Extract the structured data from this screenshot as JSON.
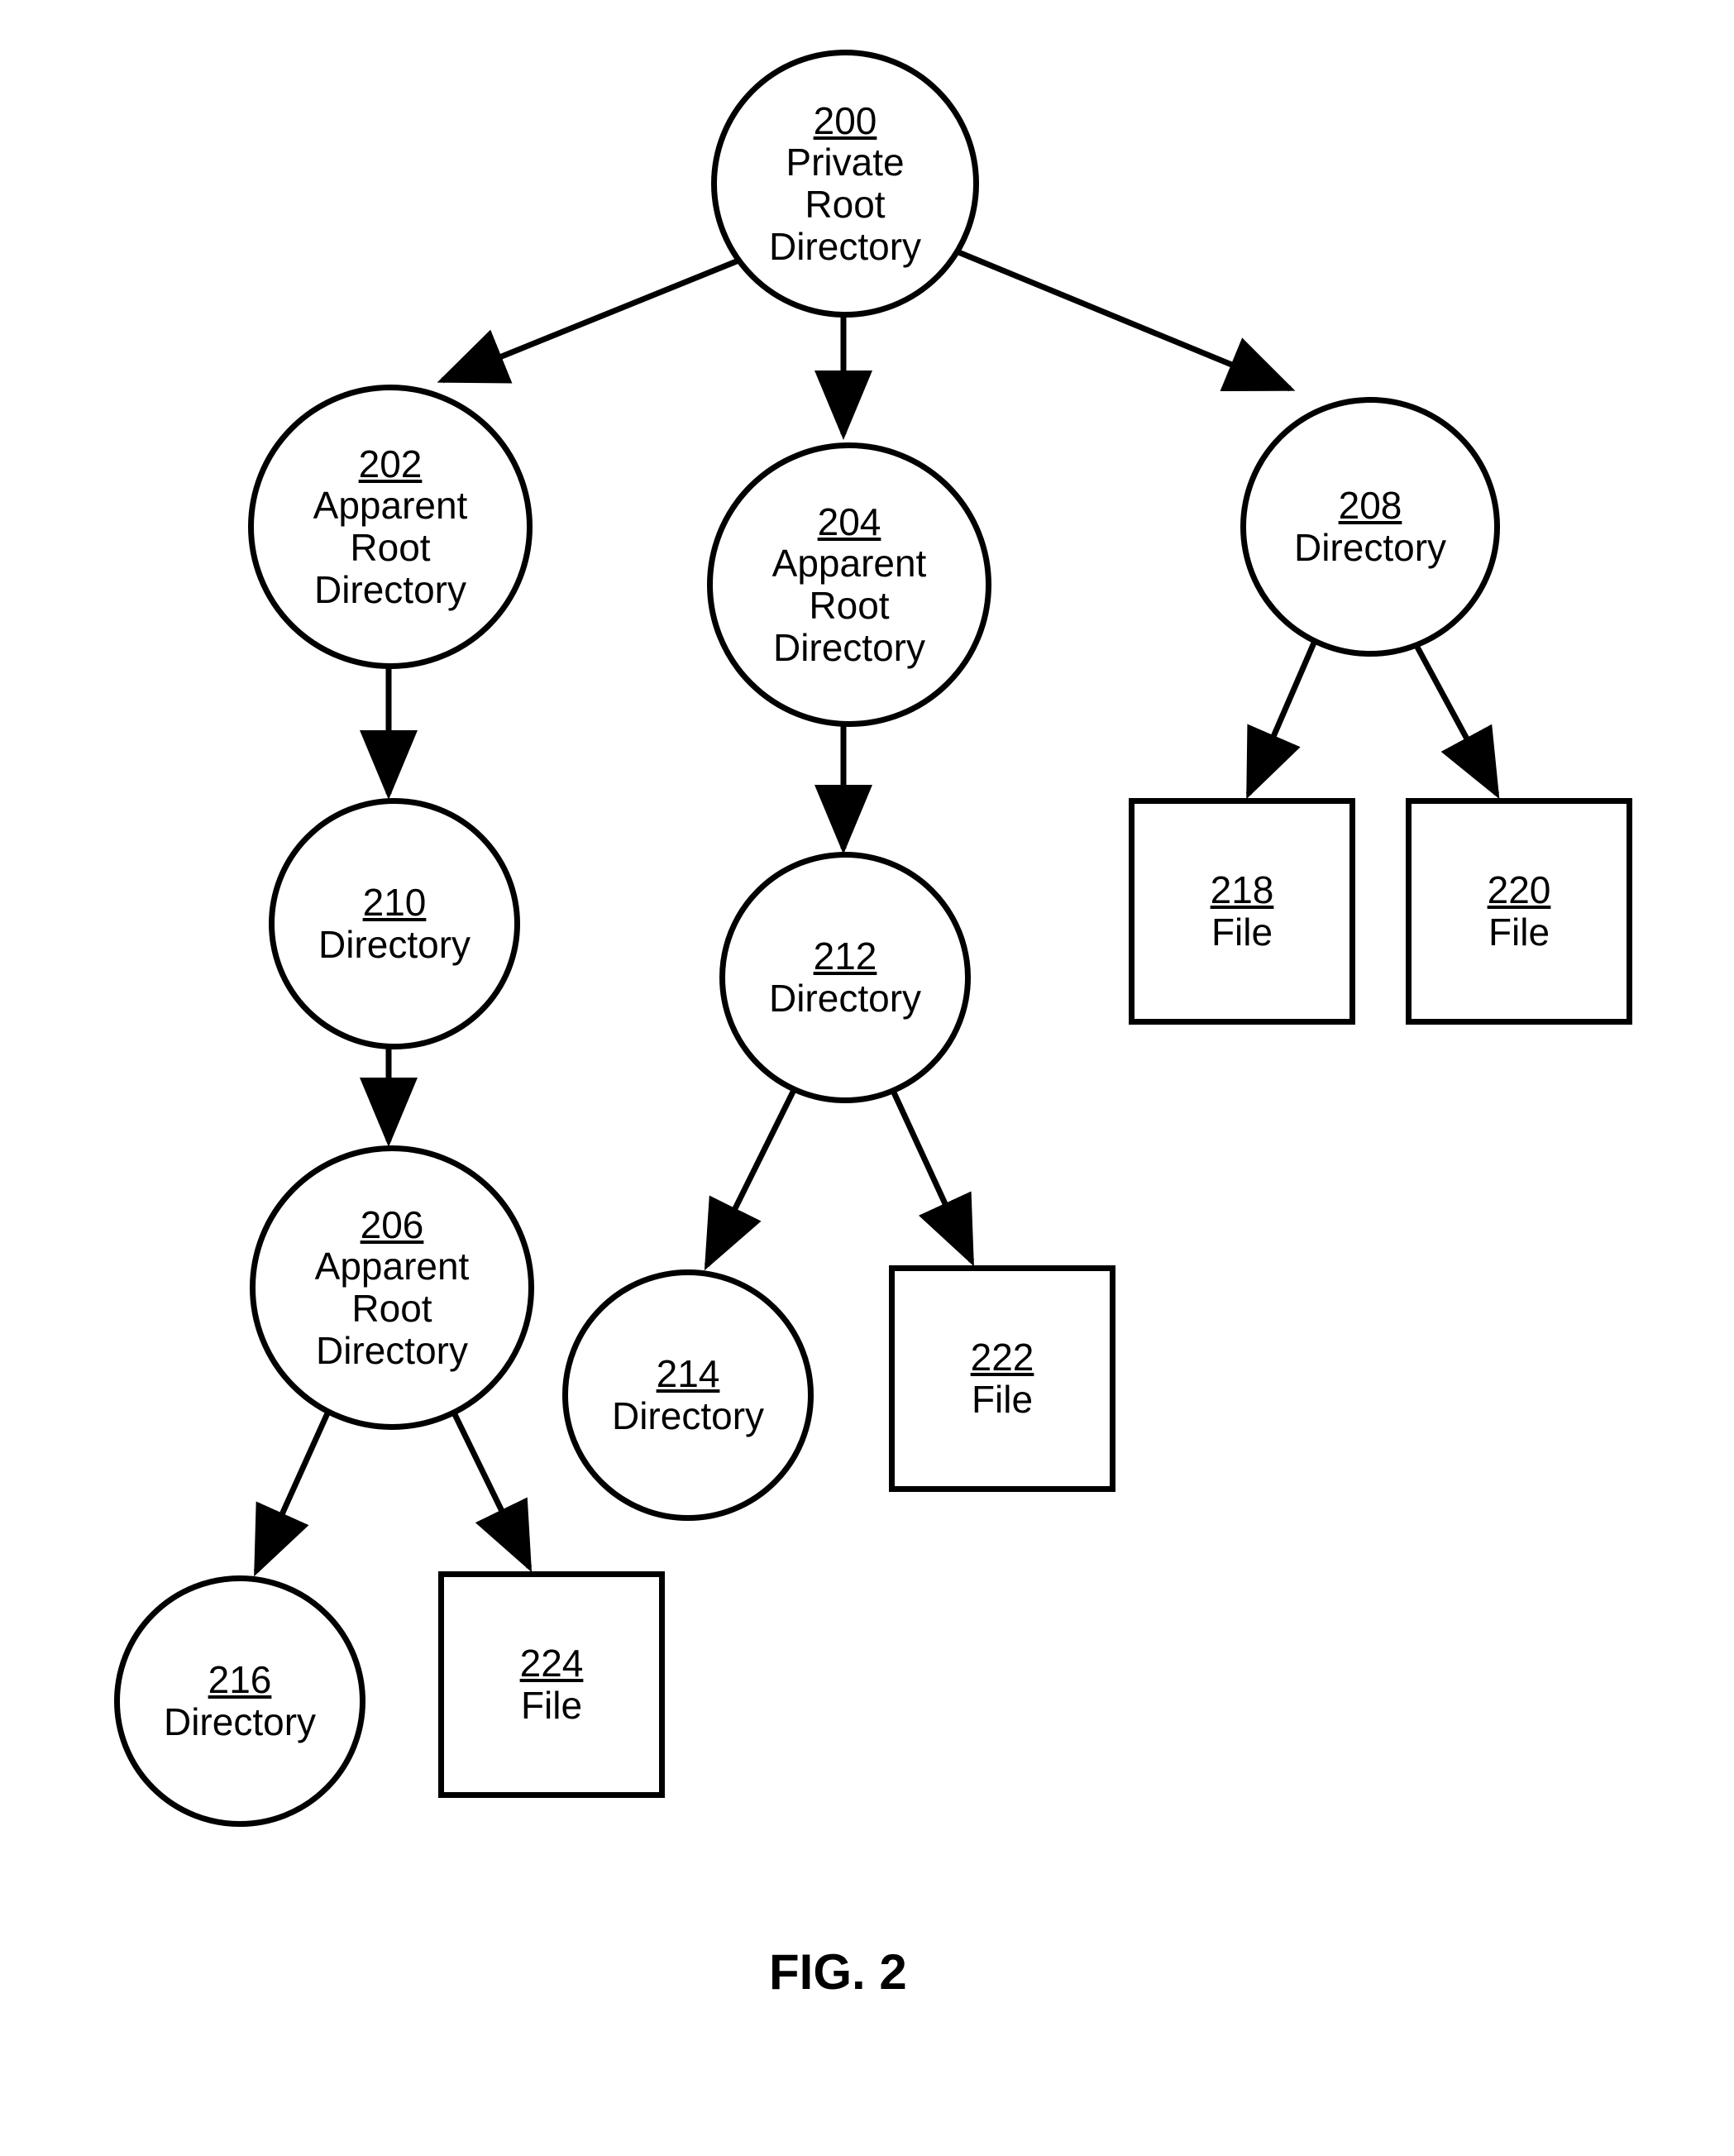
{
  "figure_label": "FIG. 2",
  "nodes": {
    "n200": {
      "num": "200",
      "label": "Private Root Directory"
    },
    "n202": {
      "num": "202",
      "label": "Apparent Root Directory"
    },
    "n204": {
      "num": "204",
      "label": "Apparent Root Directory"
    },
    "n208": {
      "num": "208",
      "label": "Directory"
    },
    "n210": {
      "num": "210",
      "label": "Directory"
    },
    "n212": {
      "num": "212",
      "label": "Directory"
    },
    "n206": {
      "num": "206",
      "label": "Apparent Root Directory"
    },
    "n214": {
      "num": "214",
      "label": "Directory"
    },
    "n216": {
      "num": "216",
      "label": "Directory"
    },
    "n218": {
      "num": "218",
      "label": "File"
    },
    "n220": {
      "num": "220",
      "label": "File"
    },
    "n222": {
      "num": "222",
      "label": "File"
    },
    "n224": {
      "num": "224",
      "label": "File"
    }
  },
  "edges": [
    {
      "from": "n200",
      "to": "n202"
    },
    {
      "from": "n200",
      "to": "n204"
    },
    {
      "from": "n200",
      "to": "n208"
    },
    {
      "from": "n202",
      "to": "n210"
    },
    {
      "from": "n204",
      "to": "n212"
    },
    {
      "from": "n208",
      "to": "n218"
    },
    {
      "from": "n208",
      "to": "n220"
    },
    {
      "from": "n210",
      "to": "n206"
    },
    {
      "from": "n212",
      "to": "n214"
    },
    {
      "from": "n212",
      "to": "n222"
    },
    {
      "from": "n206",
      "to": "n216"
    },
    {
      "from": "n206",
      "to": "n224"
    }
  ]
}
